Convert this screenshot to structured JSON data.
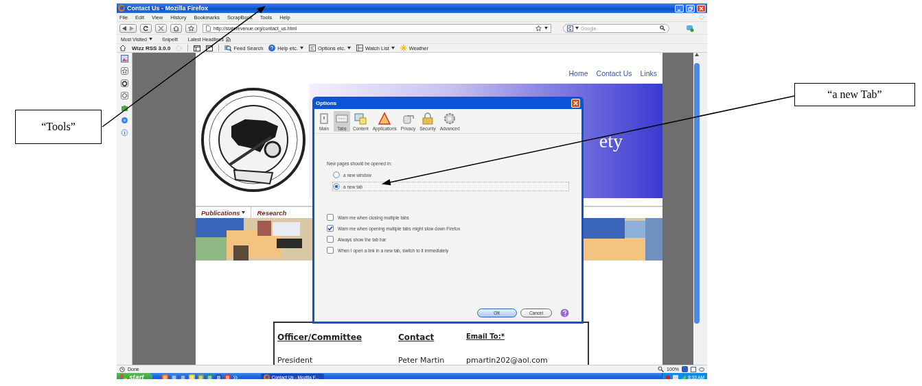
{
  "window": {
    "title": "Contact Us - Mozilla Firefox"
  },
  "menu_bar": [
    "File",
    "Edit",
    "View",
    "History",
    "Bookmarks",
    "ScrapBook",
    "Tools",
    "Help"
  ],
  "navigation": {
    "url": "http://staterevenue.org/contact_us.html",
    "search_placeholder": "Google"
  },
  "bookmarks_bar": [
    {
      "label": "Most Visited",
      "kind": "menu"
    },
    {
      "label": "SnipeIt!",
      "kind": "link"
    },
    {
      "label": "Latest Headlines",
      "kind": "feed"
    }
  ],
  "rss_toolbar": {
    "title": "Wizz RSS 3.0.0",
    "items": [
      {
        "label": "Feed Search",
        "kind": "button"
      },
      {
        "label": "Help etc.",
        "kind": "menu"
      },
      {
        "label": "Options etc.",
        "kind": "menu"
      },
      {
        "label": "Watch List",
        "kind": "menu"
      },
      {
        "label": "Weather",
        "kind": "button"
      }
    ]
  },
  "page": {
    "nav_links": [
      "Home",
      "Contact Us",
      "Links"
    ],
    "banner_text": "ety",
    "logo": {
      "kind": "picture"
    },
    "menu": [
      {
        "label": "Publications",
        "kind": "menu"
      },
      {
        "label": "Research",
        "kind": "link"
      }
    ],
    "table": {
      "columns": [
        "Officer/Committee",
        "Contact",
        "Email To:*"
      ],
      "rows": [
        [
          "President",
          "Peter Martin",
          "pmartin202@aol.com"
        ]
      ]
    }
  },
  "dialog": {
    "title": "Options",
    "tabs": [
      {
        "label": "Main",
        "selected": false
      },
      {
        "label": "Tabs",
        "selected": true
      },
      {
        "label": "Content",
        "selected": false
      },
      {
        "label": "Applications",
        "selected": false
      },
      {
        "label": "Privacy",
        "selected": false
      },
      {
        "label": "Security",
        "selected": false
      },
      {
        "label": "Advanced",
        "selected": false
      }
    ],
    "group_label": "New pages should be opened in:",
    "options": [
      {
        "label": "a new window",
        "selected": false
      },
      {
        "label": "a new tab",
        "selected": true
      }
    ],
    "checkboxes": [
      {
        "label": "Warn me when closing multiple tabs",
        "checked": false
      },
      {
        "label": "Warn me when opening multiple tabs might slow down Firefox",
        "checked": true
      },
      {
        "label": "Always show the tab bar",
        "checked": false
      },
      {
        "label": "When I open a link in a new tab, switch to it immediately",
        "checked": false
      }
    ],
    "buttons": [
      "OK",
      "Cancel"
    ]
  },
  "status_bar": {
    "text": "Done",
    "zoom": "100%"
  },
  "taskbar": {
    "start": "start",
    "windows": [
      {
        "label": "Contact Us - Mozilla F...",
        "selected": true
      }
    ],
    "clock": "8:33 AM"
  },
  "callouts": [
    "“Tools”",
    "“a new Tab”"
  ]
}
